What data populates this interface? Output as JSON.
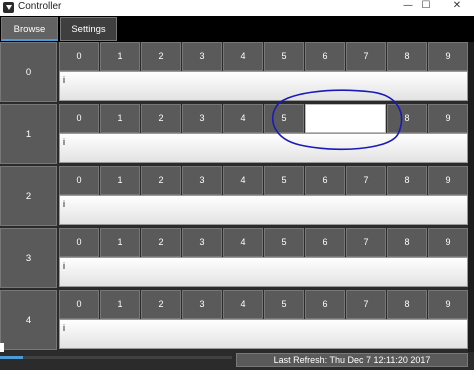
{
  "window": {
    "title": "Controller",
    "minimize_glyph": "—",
    "maximize_glyph": "☐",
    "close_glyph": "✕"
  },
  "tabs": [
    {
      "label": "Browse",
      "active": true
    },
    {
      "label": "Settings",
      "active": false
    }
  ],
  "columns": [
    "0",
    "1",
    "2",
    "3",
    "4",
    "5",
    "6",
    "7",
    "8",
    "9"
  ],
  "rows": [
    {
      "label": "0",
      "field_value": "i",
      "hidden_cells": []
    },
    {
      "label": "1",
      "field_value": "i",
      "hidden_cells": [
        6,
        7
      ]
    },
    {
      "label": "2",
      "field_value": "i",
      "hidden_cells": []
    },
    {
      "label": "3",
      "field_value": "i",
      "hidden_cells": []
    },
    {
      "label": "4",
      "field_value": "i",
      "hidden_cells": []
    }
  ],
  "status": {
    "last_refresh": "Last Refresh: Thu Dec  7 12:11:20 2017",
    "progress": 0.1
  },
  "colors": {
    "accent": "#4a9bd6",
    "annotation": "#1a1ab8",
    "button": "#5a5a5a"
  }
}
